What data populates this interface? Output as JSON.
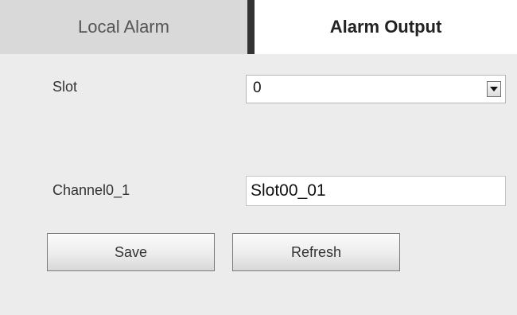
{
  "tabs": {
    "local_alarm": "Local Alarm",
    "alarm_output": "Alarm Output",
    "active": "Alarm Output"
  },
  "form": {
    "slot_label": "Slot",
    "slot_value": "0",
    "channel_label": "Channel0_1",
    "channel_value": "Slot00_01"
  },
  "buttons": {
    "save": "Save",
    "refresh": "Refresh"
  },
  "icons": {
    "dropdown": "chevron-down-icon"
  },
  "colors": {
    "background": "#ececec",
    "inactive_tab": "#d9d9d9",
    "active_tab": "#ffffff",
    "tab_divider": "#333333"
  }
}
